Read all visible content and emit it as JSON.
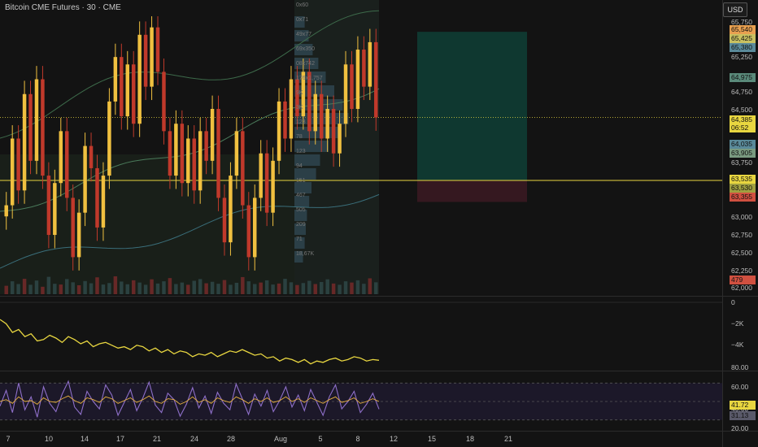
{
  "window": {
    "title": "Bitcoin CME Futures · 30 · CME",
    "currency_button": "USD"
  },
  "colors": {
    "background": "#131313",
    "candle_up": "#f0c040",
    "candle_down": "#c0392b",
    "long_profit_zone": "#0f3f36",
    "long_stop_zone": "#3a1a22",
    "line_indicator": "#e8d640",
    "rsi_line": "#8e6fc9",
    "band_line": "#3a6e7a",
    "volume_profile": "#3a5a6a"
  },
  "price_axis": {
    "ticks": [
      "65,750",
      "65,250",
      "64,750",
      "64,500",
      "63,750",
      "63,000",
      "62,750",
      "62,500",
      "62,250",
      "62,000"
    ],
    "badges": [
      {
        "text": "65,540",
        "bg": "#e8a050"
      },
      {
        "text": "65,425",
        "bg": "#c8c060"
      },
      {
        "text": "65,380",
        "bg": "#5a8a9a"
      },
      {
        "text": "64,975",
        "bg": "#5a8a7a"
      },
      {
        "text": "64,385",
        "bg": "#e8d640"
      },
      {
        "text": "06:52",
        "bg": "#e8d640"
      },
      {
        "text": "64,035",
        "bg": "#5a8a9a"
      },
      {
        "text": "63,905",
        "bg": "#7a9a80"
      },
      {
        "text": "63,535",
        "bg": "#e8d640"
      },
      {
        "text": "63,530",
        "bg": "#a0a040"
      },
      {
        "text": "63,355",
        "bg": "#d05040"
      },
      {
        "text": "479",
        "bg": "#d05040"
      }
    ]
  },
  "indicator_axis": {
    "ticks": [
      "0",
      "−2K",
      "−4K"
    ]
  },
  "rsi_axis": {
    "ticks": [
      "80.00",
      "60.00",
      "40.00",
      "20.00"
    ],
    "badges": [
      {
        "text": "41.72",
        "bg": "#e8d640"
      },
      {
        "text": "31.13",
        "bg": "#5a5a6a"
      }
    ]
  },
  "time_axis": {
    "ticks": [
      "7",
      "10",
      "14",
      "17",
      "21",
      "24",
      "28",
      "Aug",
      "5",
      "8",
      "12",
      "15",
      "18",
      "21"
    ]
  },
  "volume_profile_labels": [
    "0x60",
    "0x71",
    "49x77",
    "69x350",
    "08x742",
    "176x1,757",
    "9K",
    "3K",
    "123",
    "78",
    "123",
    "94",
    "151",
    "467",
    "505",
    "209",
    "71",
    "18,67K"
  ],
  "chart_data": {
    "type": "candlestick",
    "title": "Bitcoin CME Futures · 30 · CME",
    "ylim": [
      62000,
      65750
    ],
    "x_ticks": [
      "7",
      "10",
      "14",
      "17",
      "21",
      "24",
      "28",
      "Aug",
      "5",
      "8",
      "12",
      "15",
      "18",
      "21"
    ],
    "y_ticks": [
      65750,
      65250,
      64750,
      64500,
      63750,
      63000,
      62750,
      62500,
      62250,
      62000
    ],
    "last_price": 64385,
    "position": {
      "type": "long",
      "entry": 63535,
      "target": 65540,
      "stop": 63355
    },
    "close_series": [
      63200,
      64100,
      63400,
      64700,
      63800,
      64900,
      63600,
      62800,
      63500,
      64200,
      63300,
      62500,
      63100,
      64000,
      63700,
      62900,
      63600,
      64600,
      65200,
      64400,
      65100,
      64300,
      65500,
      64800,
      65600,
      65000,
      64200,
      63600,
      64300,
      63500,
      64100,
      63400,
      64200,
      63800,
      64500,
      63300,
      62700,
      63600,
      64200,
      63200,
      62500,
      63300,
      63900,
      63100,
      63800,
      64600,
      64100,
      64900,
      64400,
      65000,
      64200,
      64700,
      64100,
      64500,
      63900,
      64300,
      65100,
      64500,
      65300,
      64800,
      65400,
      64385
    ],
    "volume_series": [
      340,
      520,
      410,
      620,
      380,
      550,
      300,
      700,
      420,
      390,
      610,
      480,
      360,
      530,
      440,
      680,
      390,
      450,
      720,
      510,
      400,
      560,
      470,
      380,
      600,
      430,
      520,
      650,
      410,
      470,
      380,
      540,
      610,
      440,
      500,
      420,
      570,
      380,
      460,
      690,
      520,
      410,
      470,
      560,
      390,
      430,
      620,
      480,
      370,
      450,
      540,
      410,
      490,
      600,
      430,
      380,
      520,
      470,
      560,
      420,
      640,
      479
    ],
    "indicator_series": [
      -1200,
      -1500,
      -2100,
      -1900,
      -2400,
      -2200,
      -2700,
      -2600,
      -2300,
      -2500,
      -2800,
      -2400,
      -2600,
      -2900,
      -2700,
      -3100,
      -2900,
      -2800,
      -3000,
      -3200,
      -3100,
      -3300,
      -3000,
      -3100,
      -3400,
      -3200,
      -3500,
      -3300,
      -3600,
      -3400,
      -3500,
      -3800,
      -3600,
      -3700,
      -3500,
      -3800,
      -3600,
      -3400,
      -3500,
      -3300,
      -3500,
      -3700,
      -3600,
      -3900,
      -3800,
      -4100,
      -3900,
      -4000,
      -4200,
      -4000,
      -4300,
      -4100,
      -4200,
      -4000,
      -3900,
      -4100,
      -4000,
      -3800,
      -3900,
      -4100,
      -4000,
      -4050
    ],
    "rsi_series": [
      45,
      62,
      38,
      70,
      41,
      55,
      33,
      66,
      48,
      39,
      58,
      72,
      44,
      36,
      61,
      50,
      42,
      68,
      57,
      35,
      49,
      63,
      40,
      54,
      71,
      46,
      38,
      59,
      52,
      34,
      47,
      65,
      43,
      56,
      37,
      60,
      48,
      41,
      69,
      53,
      36,
      58,
      45,
      62,
      39,
      51,
      66,
      44,
      57,
      40,
      63,
      49,
      35,
      55,
      68,
      42,
      50,
      61,
      38,
      47,
      59,
      41.72
    ],
    "rsi_ma_series": [
      50,
      52,
      48,
      55,
      50,
      51,
      47,
      54,
      50,
      49,
      53,
      56,
      51,
      48,
      54,
      52,
      49,
      55,
      53,
      48,
      51,
      54,
      49,
      52,
      56,
      50,
      48,
      53,
      52,
      47,
      50,
      55,
      49,
      52,
      48,
      54,
      51,
      49,
      55,
      52,
      48,
      53,
      50,
      54,
      49,
      51,
      55,
      50,
      53,
      49,
      54,
      51,
      48,
      52,
      55,
      49,
      51,
      54,
      48,
      50,
      53,
      50
    ]
  }
}
